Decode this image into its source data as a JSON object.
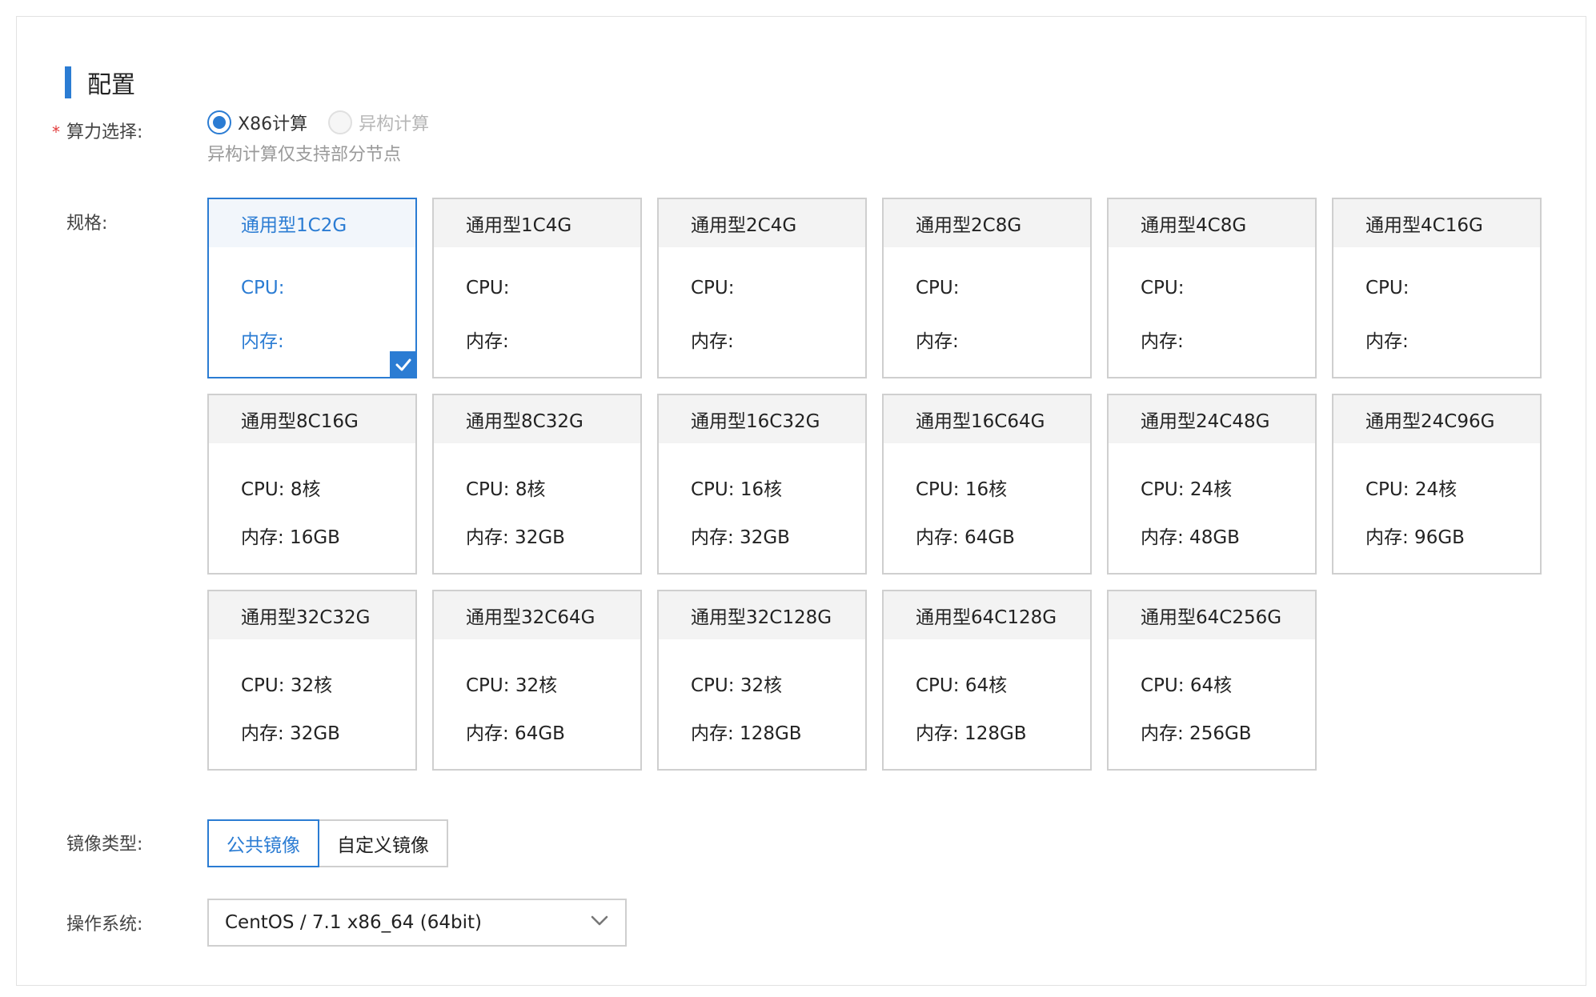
{
  "section": {
    "title": "配置"
  },
  "compute": {
    "label": "算力选择:",
    "required_mark": "*",
    "options": [
      {
        "label": "X86计算",
        "checked": true,
        "disabled": false
      },
      {
        "label": "异构计算",
        "checked": false,
        "disabled": true
      }
    ],
    "hint": "异构计算仅支持部分节点"
  },
  "spec": {
    "label": "规格:",
    "cards": [
      {
        "name": "通用型1C2G",
        "cpu": "CPU:",
        "mem": "内存:",
        "selected": true
      },
      {
        "name": "通用型1C4G",
        "cpu": "CPU:",
        "mem": "内存:"
      },
      {
        "name": "通用型2C4G",
        "cpu": "CPU:",
        "mem": "内存:"
      },
      {
        "name": "通用型2C8G",
        "cpu": "CPU:",
        "mem": "内存:"
      },
      {
        "name": "通用型4C8G",
        "cpu": "CPU:",
        "mem": "内存:"
      },
      {
        "name": "通用型4C16G",
        "cpu": "CPU:",
        "mem": "内存:"
      },
      {
        "name": "通用型8C16G",
        "cpu": "CPU:  8核",
        "mem": "内存:  16GB"
      },
      {
        "name": "通用型8C32G",
        "cpu": "CPU:  8核",
        "mem": "内存:  32GB"
      },
      {
        "name": "通用型16C32G",
        "cpu": "CPU:  16核",
        "mem": "内存:  32GB"
      },
      {
        "name": "通用型16C64G",
        "cpu": "CPU:  16核",
        "mem": "内存:  64GB"
      },
      {
        "name": "通用型24C48G",
        "cpu": "CPU:  24核",
        "mem": "内存:  48GB"
      },
      {
        "name": "通用型24C96G",
        "cpu": "CPU:  24核",
        "mem": "内存:  96GB"
      },
      {
        "name": "通用型32C32G",
        "cpu": "CPU:  32核",
        "mem": "内存:  32GB"
      },
      {
        "name": "通用型32C64G",
        "cpu": "CPU:  32核",
        "mem": "内存:  64GB"
      },
      {
        "name": "通用型32C128G",
        "cpu": "CPU:  32核",
        "mem": "内存:  128GB"
      },
      {
        "name": "通用型64C128G",
        "cpu": "CPU:  64核",
        "mem": "内存:  128GB"
      },
      {
        "name": "通用型64C256G",
        "cpu": "CPU:  64核",
        "mem": "内存:  256GB"
      }
    ]
  },
  "image_type": {
    "label": "镜像类型:",
    "options": [
      "公共镜像",
      "自定义镜像"
    ],
    "active": "公共镜像"
  },
  "os": {
    "label": "操作系统:",
    "value": "CentOS / 7.1 x86_64 (64bit)",
    "icon": "chevron-down-icon"
  },
  "colors": {
    "accent": "#2b7cd3",
    "required": "#e23b3b",
    "border": "#cfcfcf",
    "card_header": "#f3f3f3"
  }
}
